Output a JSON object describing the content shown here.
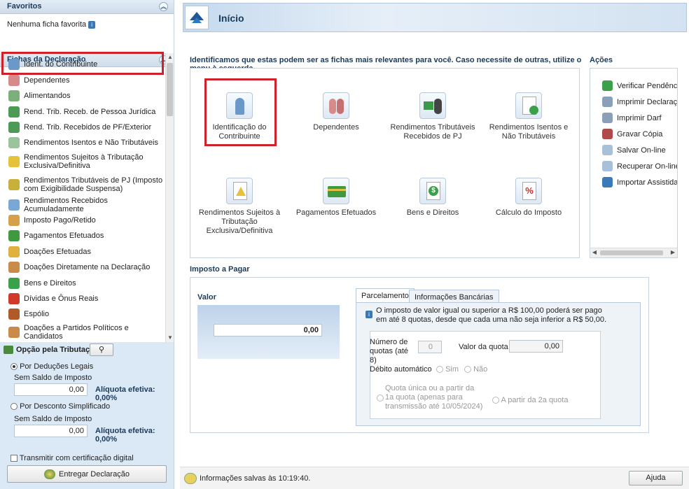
{
  "favoritos": {
    "title": "Favoritos",
    "empty": "Nenhuma ficha favorita"
  },
  "fichas": {
    "title": "Fichas da Declaração",
    "items": [
      "Ident. do Contribuinte",
      "Dependentes",
      "Alimentandos",
      "Rend. Trib. Receb. de Pessoa Jurídica",
      "Rend. Trib. Recebidos de PF/Exterior",
      "Rendimentos Isentos e Não Tributáveis",
      "Rendimentos Sujeitos à Tributação Exclusiva/Definitiva",
      "Rendimentos Tributáveis de PJ (Imposto com Exigibilidade Suspensa)",
      "Rendimentos Recebidos Acumuladamente",
      "Imposto Pago/Retido",
      "Pagamentos Efetuados",
      "Doações Efetuadas",
      "Doações Diretamente na Declaração",
      "Bens e Direitos",
      "Dívidas e Ônus Reais",
      "Espólio",
      "Doações a Partidos Políticos e Candidatos"
    ]
  },
  "opcao": {
    "title": "Opção pela Tributação:",
    "deducoes": "Por Deduções Legais",
    "desconto": "Por Desconto Simplificado",
    "saldo": "Sem Saldo de Imposto",
    "valor1": "0,00",
    "valor2": "0,00",
    "aliquota1": "Alíquota efetiva: 0,00%",
    "aliquota2": "Alíquota efetiva: 0,00%",
    "certificacao": "Transmitir com certificação digital",
    "entregar": "Entregar Declaração"
  },
  "header": {
    "title": "Início"
  },
  "relevant": {
    "intro": "Identificamos que estas podem ser as fichas mais relevantes para você. Caso necessite de outras, utilize o menu à esquerda.",
    "cards": [
      "Identificação do Contribuinte",
      "Dependentes",
      "Rendimentos Tributáveis Recebidos de PJ",
      "Rendimentos Isentos e Não Tributáveis",
      "Rendimentos Sujeitos à Tributação Exclusiva/Definitiva",
      "Pagamentos Efetuados",
      "Bens e Direitos",
      "Cálculo do Imposto"
    ]
  },
  "acoes": {
    "title": "Ações",
    "items": [
      "Verificar Pendências",
      "Imprimir Declaração",
      "Imprimir Darf",
      "Gravar Cópia",
      "Salvar On-line",
      "Recuperar On-line",
      "Importar Assistida"
    ]
  },
  "imposto": {
    "title": "Imposto a Pagar",
    "valor_label": "Valor",
    "valor": "0,00",
    "tabs": [
      "Parcelamento",
      "Informações Bancárias"
    ],
    "info": "O imposto de valor igual ou superior a R$ 100,00 poderá ser pago em até 8 quotas, desde que cada uma não seja inferior a R$ 50,00.",
    "num_quotas_label": "Número de quotas (até 8)",
    "num_quotas": "0",
    "valor_quota_label": "Valor da quota",
    "valor_quota": "0,00",
    "debito": "Débito automático",
    "sim": "Sim",
    "nao": "Não",
    "quota_unica": "Quota única ou a partir da 1a quota (apenas para transmissão até 10/05/2024)",
    "a_partir": "A partir da 2a quota"
  },
  "status": {
    "text": "Informações salvas às 10:19:40.",
    "ajuda": "Ajuda"
  },
  "colors": {
    "accent": "#1b3a5a",
    "highlight": "#d0202a",
    "panel": "#dbe8f5"
  }
}
